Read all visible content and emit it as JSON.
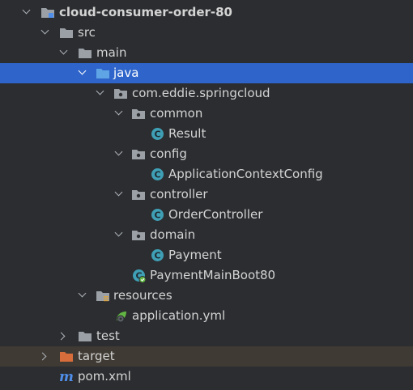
{
  "colors": {
    "background": "#2b2d30",
    "selection": "#2f65ca",
    "excluded_row": "#3f3a33",
    "folder": "#9aa0a6",
    "source_folder": "#5fa4e4",
    "excluded_folder": "#d76d3a",
    "class_icon": "#3f9fb5",
    "maven_icon": "#4f8ee9"
  },
  "tree": {
    "project": "cloud-consumer-order-80",
    "src": "src",
    "main": "main",
    "java": "java",
    "package": "com.eddie.springcloud",
    "common": "common",
    "result": "Result",
    "config": "config",
    "app_context_config": "ApplicationContextConfig",
    "controller": "controller",
    "order_controller": "OrderController",
    "domain": "domain",
    "payment": "Payment",
    "main_boot": "PaymentMainBoot80",
    "resources": "resources",
    "application_yml": "application.yml",
    "test": "test",
    "target": "target",
    "pom": "pom.xml"
  },
  "icons": {
    "class_letter": "C",
    "maven_letter": "m"
  }
}
